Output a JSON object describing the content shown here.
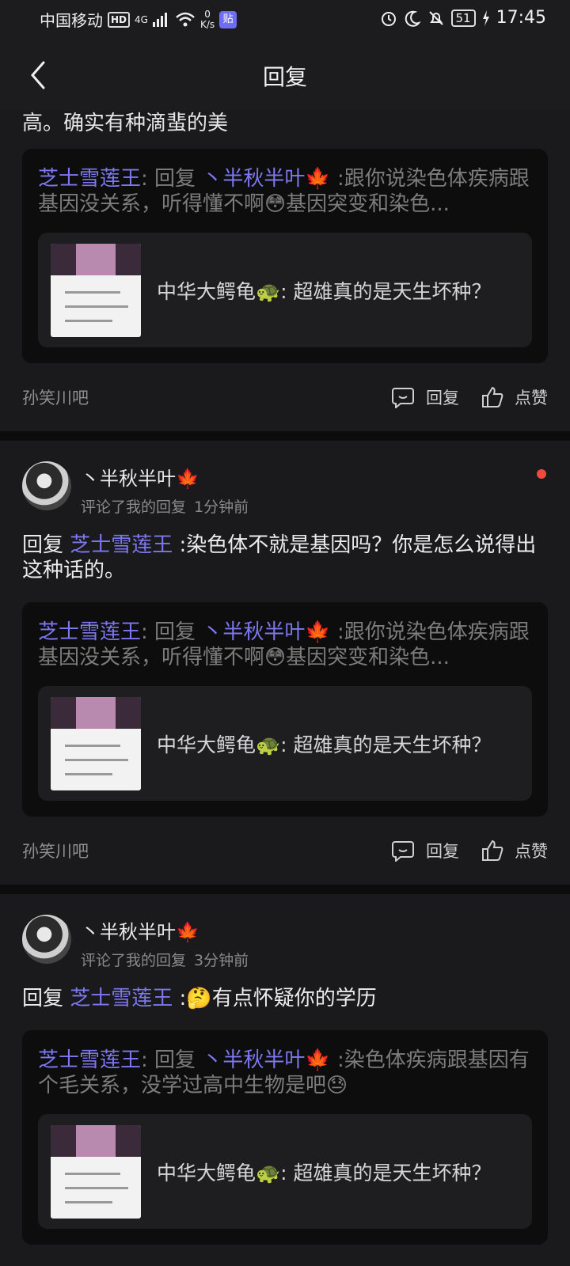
{
  "status": {
    "carrier": "中国移动",
    "hd": "HD",
    "net_type": "4G",
    "speed_value": "0",
    "speed_unit": "K/s",
    "app_badge": "贴",
    "battery": "51",
    "time": "17:45"
  },
  "header": {
    "title": "回复"
  },
  "top_partial": {
    "text": "高。确实有种滴蜚的美"
  },
  "emoji": {
    "leaf": "🍁",
    "turtle": "🐢",
    "blush": "😳",
    "think": "🤔",
    "sweat": "😓"
  },
  "cards": [
    {
      "quote": {
        "author": "芝士雪莲王",
        "reply_word": ": 回复 ",
        "target": "丶半秋半叶",
        "text_a": " :跟你说染色体疾病跟基因没关系，听得懂不啊",
        "text_b": "基因突变和染色..."
      },
      "origin": {
        "author": "中华大鳄龟",
        "text": ": 超雄真的是天生坏种？"
      },
      "footer": {
        "forum": "孙笑川吧",
        "reply": "回复",
        "like": "点赞"
      }
    },
    {
      "user": {
        "name": "丶半秋半叶",
        "action": "评论了我的回复",
        "time": "1分钟前"
      },
      "reply": {
        "prefix": "回复 ",
        "mention": "芝士雪莲王",
        "text": " :染色体不就是基因吗？你是怎么说得出这种话的。"
      },
      "quote": {
        "author": "芝士雪莲王",
        "reply_word": ": 回复 ",
        "target": "丶半秋半叶",
        "text_a": " :跟你说染色体疾病跟基因没关系，听得懂不啊",
        "text_b": "基因突变和染色..."
      },
      "origin": {
        "author": "中华大鳄龟",
        "text": ": 超雄真的是天生坏种？"
      },
      "footer": {
        "forum": "孙笑川吧",
        "reply": "回复",
        "like": "点赞"
      }
    },
    {
      "user": {
        "name": "丶半秋半叶",
        "action": "评论了我的回复",
        "time": "3分钟前"
      },
      "reply": {
        "prefix": "回复 ",
        "mention": "芝士雪莲王",
        "text_colon": " :",
        "text": "有点怀疑你的学历"
      },
      "quote": {
        "author": "芝士雪莲王",
        "reply_word": ": 回复 ",
        "target": "丶半秋半叶",
        "text_a": " :染色体疾病跟基因有个毛关系，没学过高中生物是吧"
      },
      "origin": {
        "author": "中华大鳄龟",
        "text": ": 超雄真的是天生坏种？"
      }
    }
  ]
}
